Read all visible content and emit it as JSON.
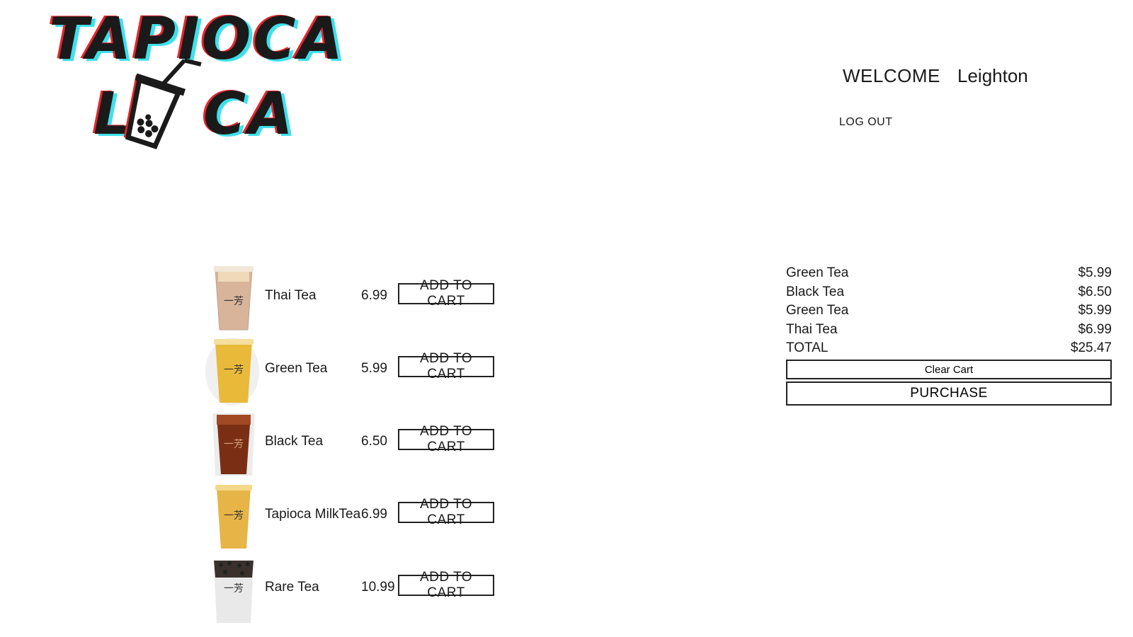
{
  "logo": {
    "line1": "TAPIOCA",
    "line2_left": "L",
    "line2_right": "CA",
    "colors": {
      "main": "#1a1a1a",
      "shadow_red": "#e8262d",
      "shadow_cyan": "#3fe0ea"
    }
  },
  "header": {
    "welcome_label": "WELCOME",
    "username": "Leighton",
    "logout_label": "LOG OUT"
  },
  "products": [
    {
      "name": "Thai Tea",
      "price": "6.99",
      "button_label": "ADD TO CART",
      "cup_color": "#d8b49a",
      "icon": "thai-tea-cup-icon"
    },
    {
      "name": "Green Tea",
      "price": "5.99",
      "button_label": "ADD TO CART",
      "cup_color": "#e9b93a",
      "icon": "green-tea-cup-icon"
    },
    {
      "name": "Black Tea",
      "price": "6.50",
      "button_label": "ADD TO CART",
      "cup_color": "#7a2f14",
      "icon": "black-tea-cup-icon"
    },
    {
      "name": "Tapioca MilkTea",
      "price": "6.99",
      "button_label": "ADD TO CART",
      "cup_color": "#e6b447",
      "icon": "tapioca-milk-tea-cup-icon"
    },
    {
      "name": "Rare Tea",
      "price": "10.99",
      "button_label": "ADD TO CART",
      "cup_color": "#e9e9ea",
      "icon": "rare-tea-cup-icon"
    }
  ],
  "cart": {
    "items": [
      {
        "name": "Green Tea",
        "price": "$5.99"
      },
      {
        "name": "Black Tea",
        "price": "$6.50"
      },
      {
        "name": "Green Tea",
        "price": "$5.99"
      },
      {
        "name": "Thai Tea",
        "price": "$6.99"
      }
    ],
    "total_label": "TOTAL",
    "total_value": "$25.47",
    "clear_label": "Clear Cart",
    "purchase_label": "PURCHASE"
  }
}
